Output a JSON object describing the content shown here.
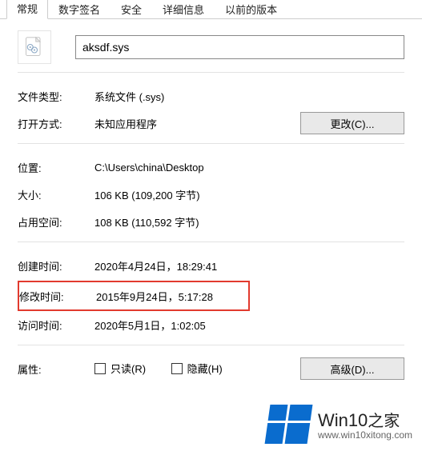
{
  "tabs": {
    "general": "常规",
    "signature": "数字签名",
    "security": "安全",
    "details": "详细信息",
    "previous": "以前的版本"
  },
  "filename": "aksdf.sys",
  "labels": {
    "filetype": "文件类型:",
    "openwith": "打开方式:",
    "location": "位置:",
    "size": "大小:",
    "sizeondisk": "占用空间:",
    "created": "创建时间:",
    "modified": "修改时间:",
    "accessed": "访问时间:",
    "attributes": "属性:"
  },
  "values": {
    "filetype": "系统文件 (.sys)",
    "openwith": "未知应用程序",
    "location": "C:\\Users\\china\\Desktop",
    "size": "106 KB (109,200 字节)",
    "sizeondisk": "108 KB (110,592 字节)",
    "created": "2020年4月24日，18:29:41",
    "modified": "2015年9月24日，5:17:28",
    "accessed": "2020年5月1日，1:02:05"
  },
  "buttons": {
    "change": "更改(C)...",
    "advanced": "高级(D)..."
  },
  "checkboxes": {
    "readonly": "只读(R)",
    "hidden": "隐藏(H)"
  },
  "watermark": {
    "brand_en": "Win10",
    "brand_zh": "之家",
    "url": "www.win10xitong.com"
  }
}
